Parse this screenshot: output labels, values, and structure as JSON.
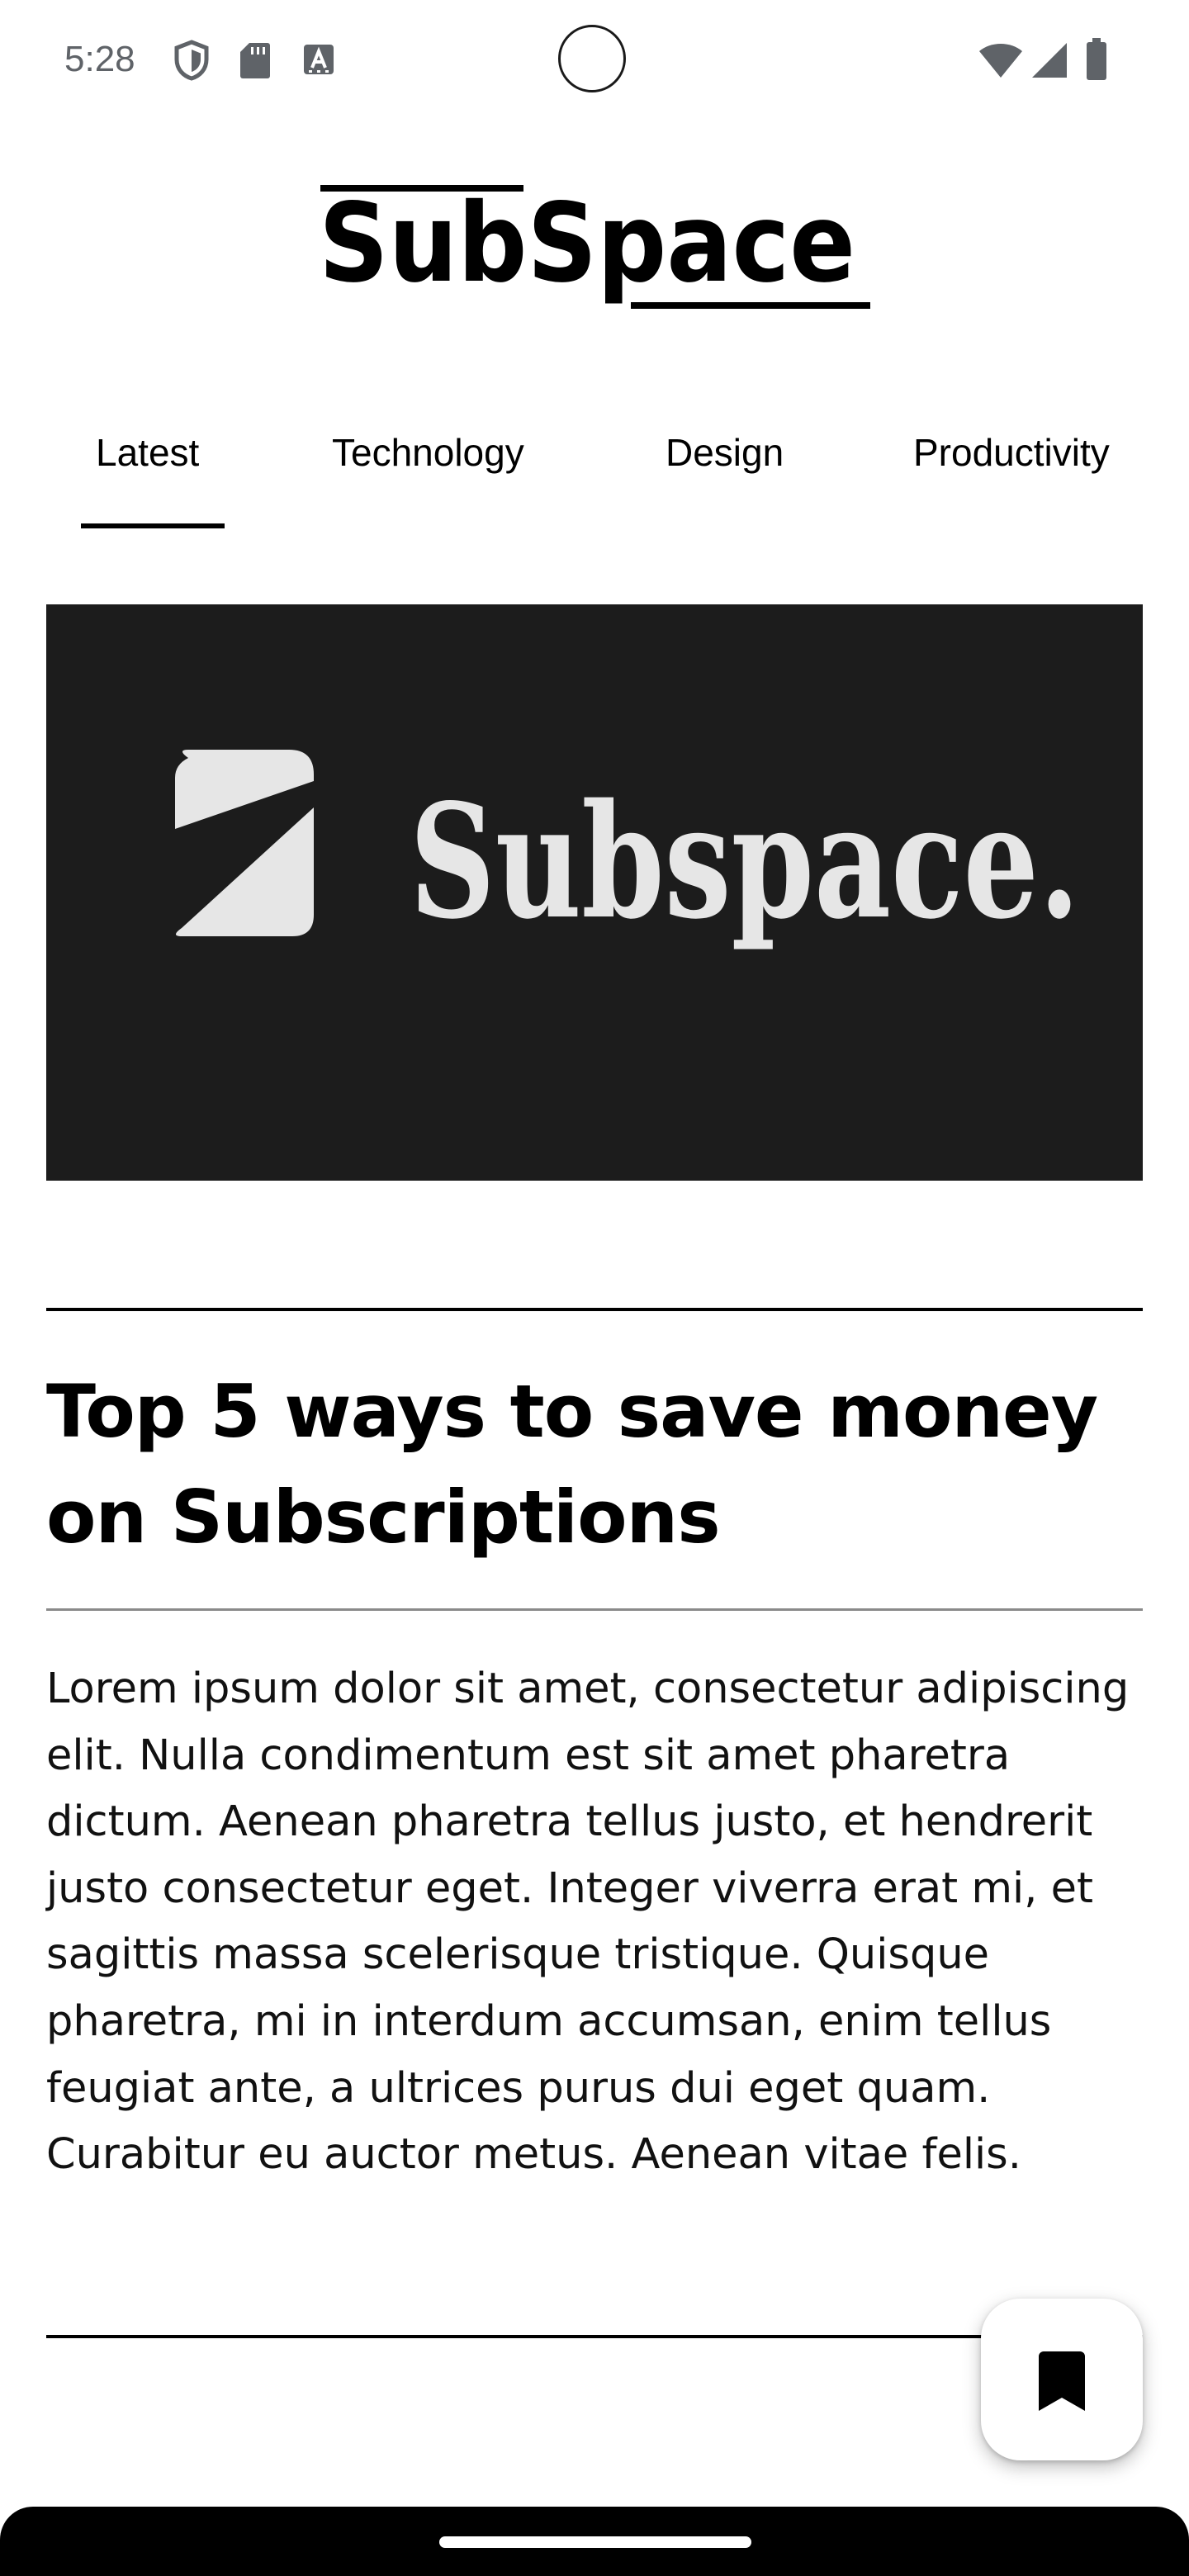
{
  "status_bar": {
    "time": "5:28",
    "left_icons": [
      "shield-icon",
      "sd-card-icon",
      "keyboard-a-icon"
    ],
    "right_icons": [
      "wifi-icon",
      "cell-signal-icon",
      "battery-icon"
    ],
    "icon_color": "#5f6368"
  },
  "header": {
    "logo_text": "SubSpace"
  },
  "tabs": [
    {
      "label": "Latest",
      "selected": true
    },
    {
      "label": "Technology",
      "selected": false
    },
    {
      "label": "Design",
      "selected": false
    },
    {
      "label": "Productivity",
      "selected": false
    }
  ],
  "hero": {
    "logo_text": "Subspace.",
    "background": "#1c1c1c",
    "logo_color": "#e6e6e6"
  },
  "article": {
    "title": "Top 5 ways to save money on Subscriptions",
    "body": "Lorem ipsum dolor sit amet, consectetur adipiscing elit. Nulla condimentum est sit amet pharetra dictum. Aenean pharetra tellus justo, et hendrerit justo consectetur eget. Integer viverra erat mi, et sagittis massa scelerisque tristique. Quisque pharetra, mi in interdum accumsan, enim tellus feugiat ante, a ultrices purus dui eget quam. Curabitur eu auctor metus. Aenean vitae felis."
  },
  "fab": {
    "icon": "bookmark-icon"
  },
  "colors": {
    "accent": "#000000",
    "background": "#ffffff",
    "status_text": "#5f6368"
  }
}
